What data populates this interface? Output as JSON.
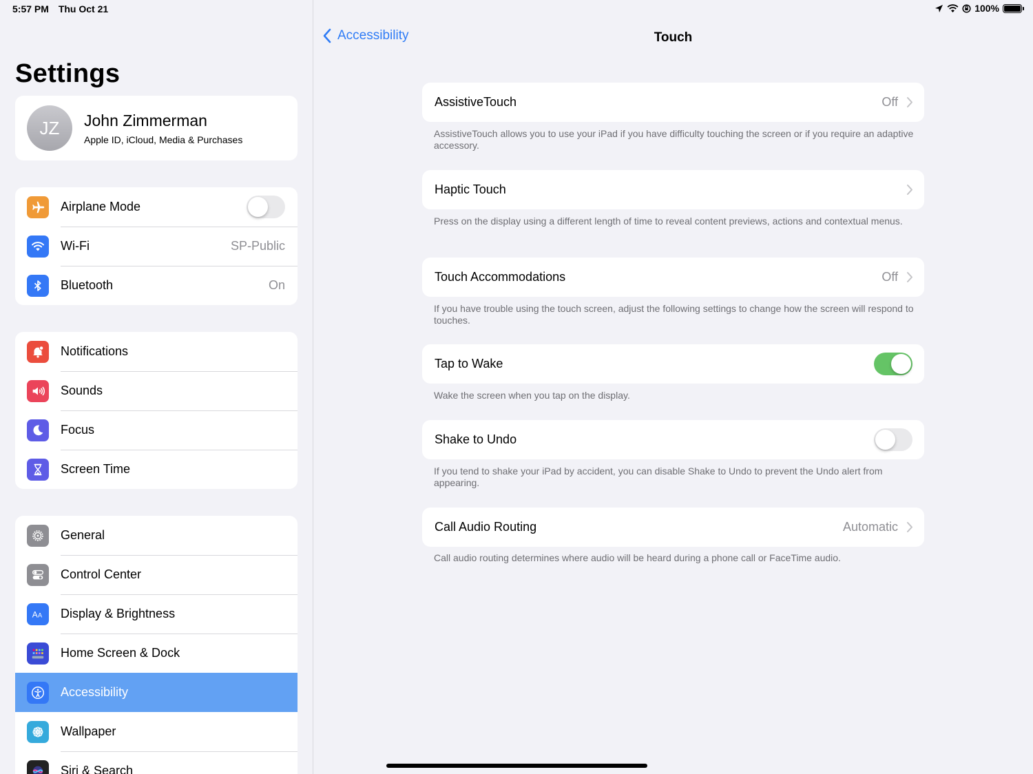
{
  "status": {
    "time": "5:57 PM",
    "date": "Thu Oct 21",
    "battery": "100%"
  },
  "sidebar": {
    "title": "Settings",
    "profile": {
      "initials": "JZ",
      "name": "John Zimmerman",
      "subtitle": "Apple ID, iCloud, Media & Purchases"
    },
    "group1": [
      {
        "label": "Airplane Mode",
        "toggle": false,
        "icon": "airplane-icon",
        "color": "#f09a37"
      },
      {
        "label": "Wi-Fi",
        "value": "SP-Public",
        "icon": "wifi-icon",
        "color": "#3478f6"
      },
      {
        "label": "Bluetooth",
        "value": "On",
        "icon": "bluetooth-icon",
        "color": "#3478f6"
      }
    ],
    "group2": [
      {
        "label": "Notifications",
        "icon": "notifications-icon",
        "color": "#eb4d3d"
      },
      {
        "label": "Sounds",
        "icon": "sounds-icon",
        "color": "#eb445a"
      },
      {
        "label": "Focus",
        "icon": "focus-icon",
        "color": "#5e5ce6"
      },
      {
        "label": "Screen Time",
        "icon": "hourglass-icon",
        "color": "#5e5ce6"
      }
    ],
    "group3": [
      {
        "label": "General",
        "icon": "gear-icon",
        "color": "#8e8e93"
      },
      {
        "label": "Control Center",
        "icon": "control-center-icon",
        "color": "#8e8e93"
      },
      {
        "label": "Display & Brightness",
        "icon": "display-icon",
        "color": "#3478f6"
      },
      {
        "label": "Home Screen & Dock",
        "icon": "home-screen-icon",
        "color": "#3a4bd6"
      },
      {
        "label": "Accessibility",
        "icon": "accessibility-icon",
        "color": "#3478f6",
        "selected": true
      },
      {
        "label": "Wallpaper",
        "icon": "wallpaper-icon",
        "color": "#35aadc"
      },
      {
        "label": "Siri & Search",
        "icon": "siri-icon",
        "color": "#222222"
      }
    ]
  },
  "detail": {
    "back_label": "Accessibility",
    "title": "Touch",
    "items": [
      {
        "label": "AssistiveTouch",
        "value": "Off",
        "chevron": true,
        "footer": "AssistiveTouch allows you to use your iPad if you have difficulty touching the screen or if you require an adaptive accessory."
      },
      {
        "label": "Haptic Touch",
        "value": "",
        "chevron": true,
        "footer": "Press on the display using a different length of time to reveal content previews, actions and contextual menus."
      },
      {
        "label": "Touch Accommodations",
        "value": "Off",
        "chevron": true,
        "footer": "If you have trouble using the touch screen, adjust the following settings to change how the screen will respond to touches."
      },
      {
        "label": "Tap to Wake",
        "toggle": true,
        "footer": "Wake the screen when you tap on the display."
      },
      {
        "label": "Shake to Undo",
        "toggle": false,
        "footer": "If you tend to shake your iPad by accident, you can disable Shake to Undo to prevent the Undo alert from appearing."
      },
      {
        "label": "Call Audio Routing",
        "value": "Automatic",
        "chevron": true,
        "footer": "Call audio routing determines where audio will be heard during a phone call or FaceTime audio."
      }
    ]
  },
  "colors": {
    "accent": "#2f7cf6",
    "selected": "#62a1f3",
    "toggle_on": "#65c466"
  }
}
